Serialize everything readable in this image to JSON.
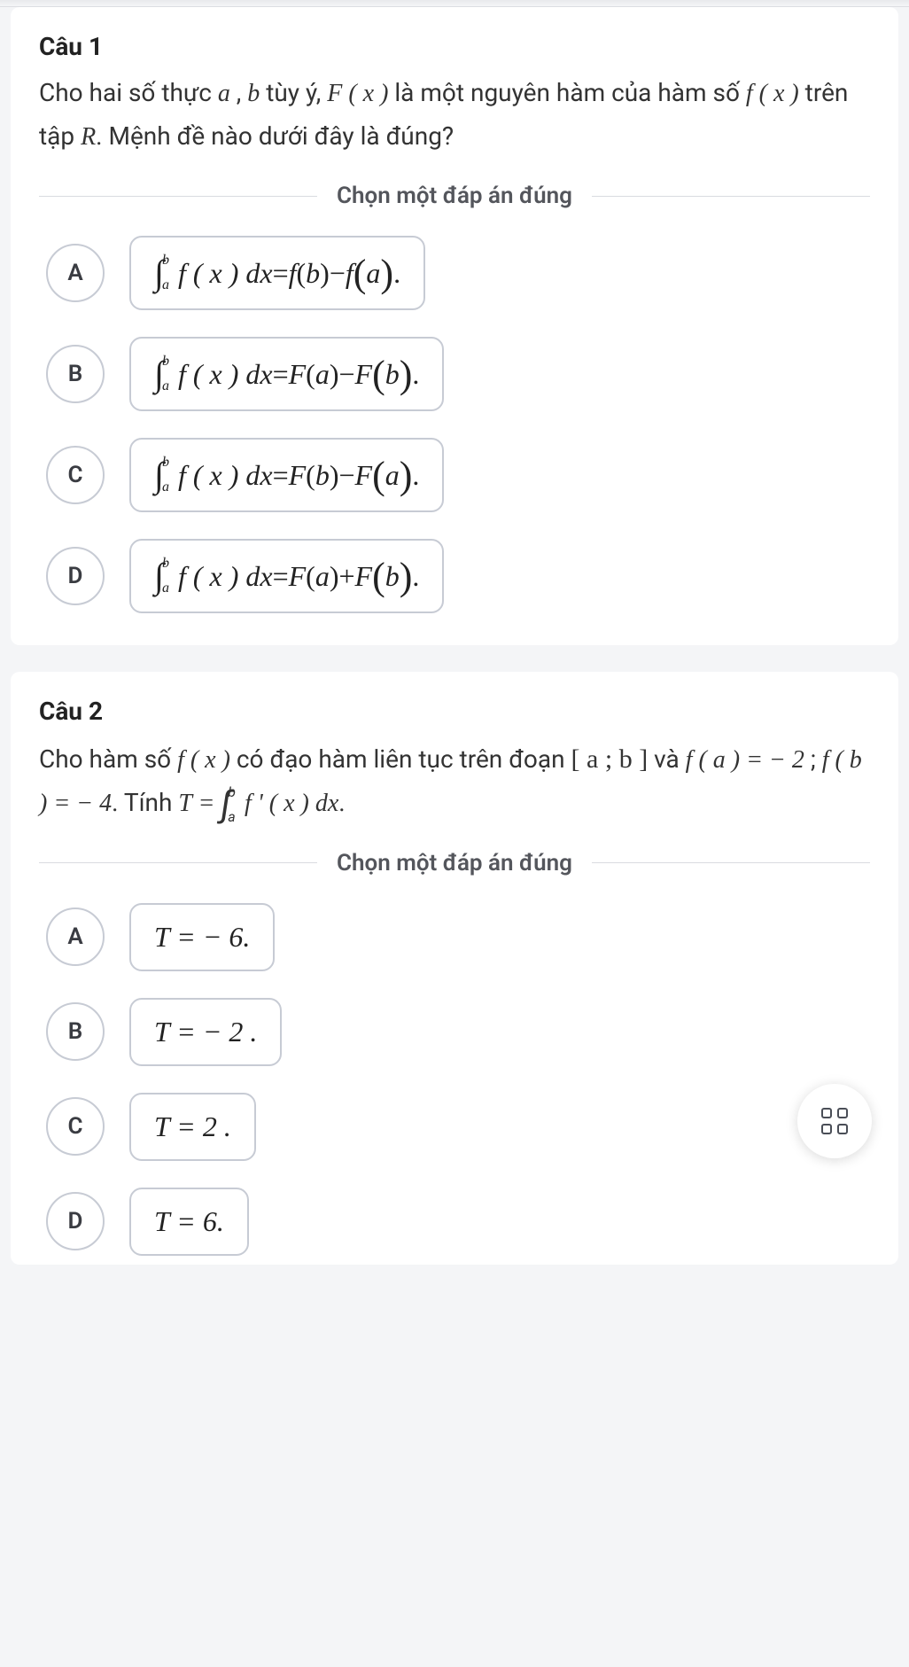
{
  "q1": {
    "title": "Câu 1",
    "text_parts": {
      "p1": "Cho hai số thực ",
      "a": "a",
      "comma": " , ",
      "b": "b",
      "p2": " tùy ý, ",
      "Fx": "F ( x )",
      "p3": " là một nguyên hàm của hàm số ",
      "fx": "f ( x )",
      "p4": " trên tập ",
      "R": "R",
      "p5": ". Mệnh đề nào dưới đây là đúng?"
    },
    "prompt": "Chọn một đáp án đúng",
    "options": {
      "A": {
        "letter": "A",
        "lhs_func": "f",
        "rhs1_func": "f",
        "rhs1_arg": "b",
        "op": " − ",
        "rhs2_func": "f",
        "rhs2_arg": "a"
      },
      "B": {
        "letter": "B",
        "lhs_func": "f",
        "rhs1_func": "F",
        "rhs1_arg": "a",
        "op": " − ",
        "rhs2_func": "F",
        "rhs2_arg": "b"
      },
      "C": {
        "letter": "C",
        "lhs_func": "f",
        "rhs1_func": "F",
        "rhs1_arg": "b",
        "op": " − ",
        "rhs2_func": "F",
        "rhs2_arg": "a"
      },
      "D": {
        "letter": "D",
        "lhs_func": "f",
        "rhs1_func": "F",
        "rhs1_arg": "a",
        "op": " + ",
        "rhs2_func": "F",
        "rhs2_arg": "b"
      }
    },
    "int_upper": "b",
    "int_lower": "a",
    "int_body": "f ( x ) dx",
    "eq": " = ",
    "period": " ."
  },
  "q2": {
    "title": "Câu 2",
    "text_parts": {
      "p1": "Cho hàm số ",
      "fx": "f ( x )",
      "p2": " có đạo hàm liên tục trên đoạn ",
      "interval": "[ a ; b ]",
      "p3": " và ",
      "fa": "f ( a ) = − 2",
      "semi": " ; ",
      "fb": "f ( b ) = − 4",
      "p4": ". Tính ",
      "Teq": "T = ",
      "int_upper": "b",
      "int_lower": "a",
      "int_body": "f ' ( x ) dx",
      "period2": "."
    },
    "prompt": "Chọn một đáp án đúng",
    "options": {
      "A": {
        "letter": "A",
        "text": "T = − 6."
      },
      "B": {
        "letter": "B",
        "text": "T = − 2 ."
      },
      "C": {
        "letter": "C",
        "text": "T = 2 ."
      },
      "D": {
        "letter": "D",
        "text": "T = 6."
      }
    }
  }
}
